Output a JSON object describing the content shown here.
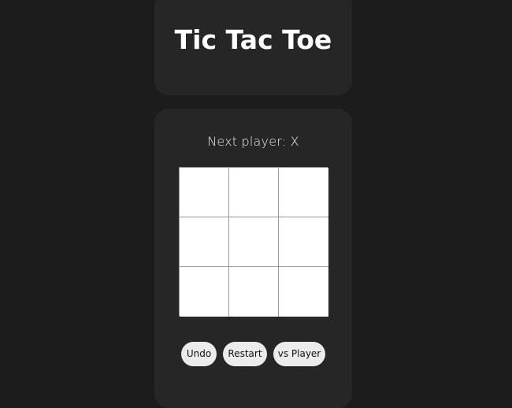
{
  "header": {
    "title": "Tic Tac Toe"
  },
  "game": {
    "status": "Next player: X",
    "board": [
      "",
      "",
      "",
      "",
      "",
      "",
      "",
      "",
      ""
    ]
  },
  "controls": {
    "undo_label": "Undo",
    "restart_label": "Restart",
    "mode_label": "vs Player"
  },
  "colors": {
    "page_background": "#1c1c1c",
    "card_background": "#262626",
    "board_background": "#ffffff",
    "grid_lines": "#9a9a9a",
    "button_background": "#ebebeb",
    "title_text": "#ffffff"
  }
}
